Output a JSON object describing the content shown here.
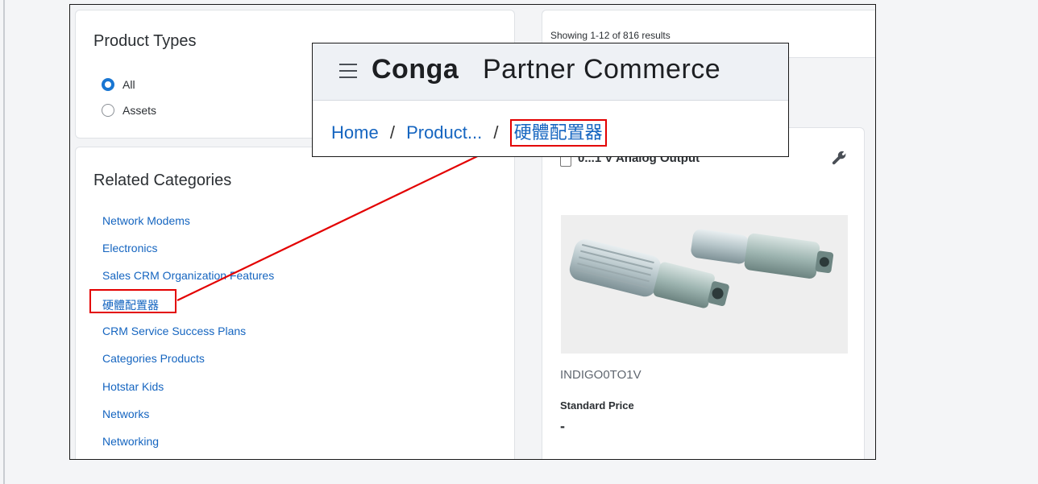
{
  "product_types": {
    "title": "Product Types",
    "options": [
      {
        "label": "All",
        "selected": true
      },
      {
        "label": "Assets",
        "selected": false
      }
    ]
  },
  "related_categories": {
    "title": "Related Categories",
    "items": [
      "Network Modems",
      "Electronics",
      "Sales CRM Organization Features",
      "硬體配置器",
      "CRM Service Success Plans",
      "Categories Products",
      "Hotstar Kids",
      "Networks",
      "Networking"
    ]
  },
  "results": {
    "count_text": "Showing 1-12 of 816 results"
  },
  "product": {
    "name": "0...1 V Analog Output",
    "code": "INDIGO0TO1V",
    "price_label": "Standard Price",
    "price_value": "-",
    "wrench_icon": "wrench-icon"
  },
  "callout": {
    "brand_bold": "Conga",
    "brand_rest": "Partner Commerce",
    "breadcrumb": [
      "Home",
      "Product...",
      "硬體配置器"
    ],
    "breadcrumb_separator": "/"
  },
  "annotation": {
    "color": "#e30000"
  }
}
